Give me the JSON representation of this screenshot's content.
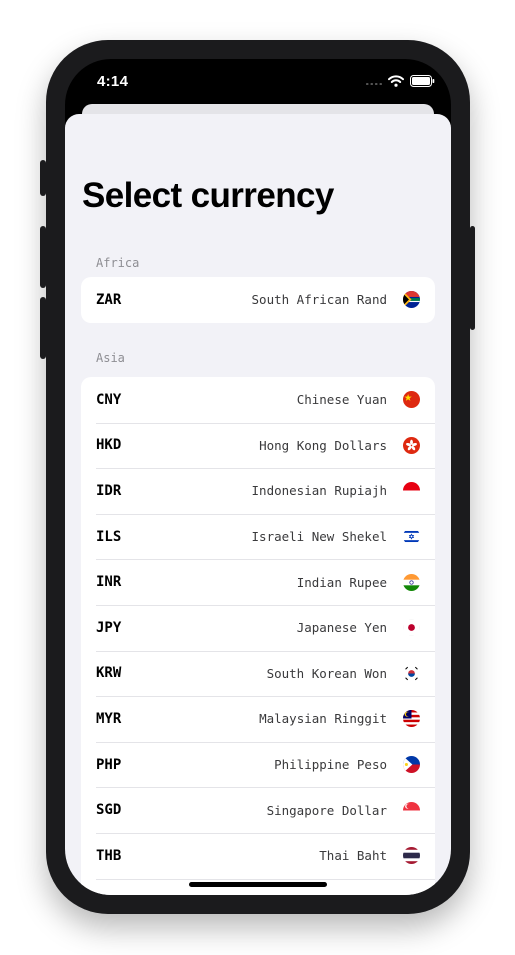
{
  "status_bar": {
    "time": "4:14"
  },
  "title": "Select currency",
  "sections": [
    {
      "header": "Africa",
      "items": [
        {
          "code": "ZAR",
          "name": "South African Rand",
          "flag_icon": "south-africa-flag-icon"
        }
      ]
    },
    {
      "header": "Asia",
      "items": [
        {
          "code": "CNY",
          "name": "Chinese Yuan",
          "flag_icon": "china-flag-icon"
        },
        {
          "code": "HKD",
          "name": "Hong Kong Dollars",
          "flag_icon": "hong-kong-flag-icon"
        },
        {
          "code": "IDR",
          "name": "Indonesian Rupiajh",
          "flag_icon": "indonesia-flag-icon"
        },
        {
          "code": "ILS",
          "name": "Israeli New Shekel",
          "flag_icon": "israel-flag-icon"
        },
        {
          "code": "INR",
          "name": "Indian Rupee",
          "flag_icon": "india-flag-icon"
        },
        {
          "code": "JPY",
          "name": "Japanese Yen",
          "flag_icon": "japan-flag-icon"
        },
        {
          "code": "KRW",
          "name": "South Korean Won",
          "flag_icon": "south-korea-flag-icon"
        },
        {
          "code": "MYR",
          "name": "Malaysian Ringgit",
          "flag_icon": "malaysia-flag-icon"
        },
        {
          "code": "PHP",
          "name": "Philippine Peso",
          "flag_icon": "philippines-flag-icon"
        },
        {
          "code": "SGD",
          "name": "Singapore Dollar",
          "flag_icon": "singapore-flag-icon"
        },
        {
          "code": "THB",
          "name": "Thai Baht",
          "flag_icon": "thailand-flag-icon"
        }
      ]
    }
  ],
  "colors": {
    "sheet_background": "#f2f2f7",
    "cell_background": "#ffffff",
    "section_header_text": "#8e8e93",
    "phone_bezel": "#1b1b1d"
  }
}
